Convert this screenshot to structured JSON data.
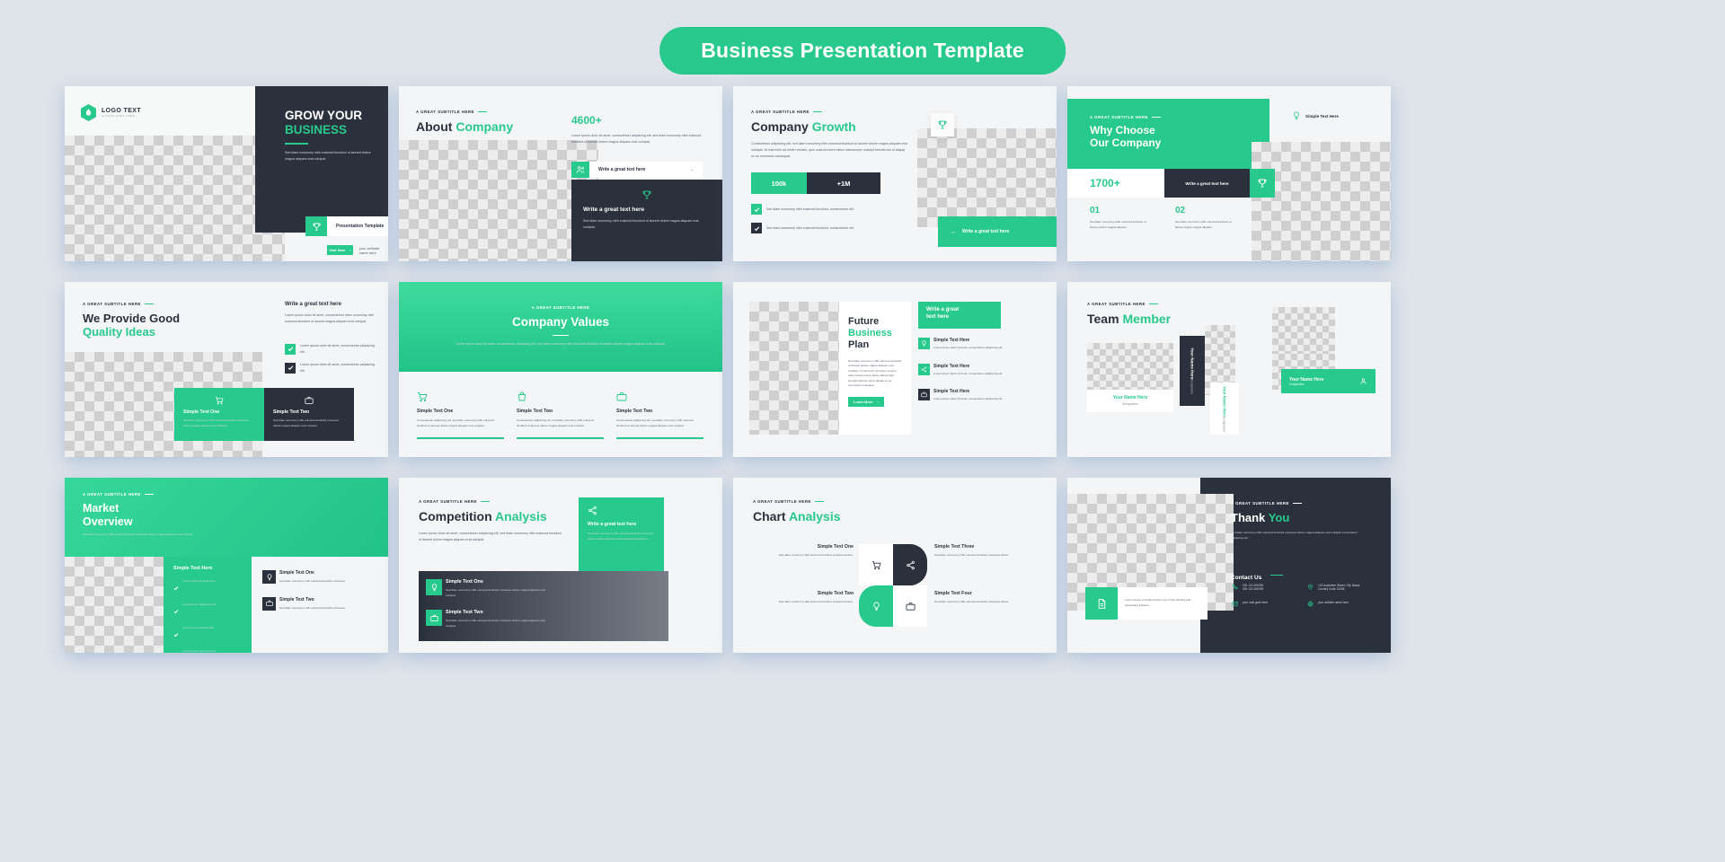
{
  "header": {
    "title": "Business Presentation Template"
  },
  "theme": {
    "accent": "#27c98c",
    "dark": "#2b313c",
    "page_bg": "#dfe3ea",
    "slide_bg": "#f4f5f6"
  },
  "common": {
    "eyebrow": "A GREAT SUBTITLE HERE",
    "lorem_short": "Lorem ipsum dolor sit amet, consectetuer adipiscing elit.",
    "lorem_mid": "Lorem ipsum dolor sit amet, consectetuer adipiscing elit, sed diam nonummy nibh euismod tincidunt ut laoreet dolore magna aliquam erat volutpat.",
    "lorem_long": "Consectetuer adipiscing elit, sed diam nonummy nibh euismod tincidunt ut laoreet dolore magna aliquam erat volutpat. Ut wisi enim ad minim veniam, quis nostrud exerci tation ullamcorper suscipit lobortis nisl ut aliquip ex ea commodo consequat.",
    "body_dark": "Sed diam nonummy nibh euismod tincidunt ut laoreet dolore magna aliquam erat volutpat.",
    "write_great": "Write a great text here",
    "simple_text_here": "Simple Text Here"
  },
  "slides": [
    {
      "id": "slide-cover",
      "logo": {
        "text": "LOGO TEXT",
        "slogan": "SLOGAN GOES HERE"
      },
      "title_line1": "GROW YOUR",
      "title_line2": "BUSINESS",
      "body": "Sed diam nonummy nibh euismod tincidunt ut laoreet dolore magna aliquam erat volutpat.",
      "cta_label": "Presentation Template",
      "visit_label": "Visit Now",
      "website_label": "your website name here"
    },
    {
      "id": "slide-about",
      "eyebrow": "A GREAT SUBTITLE HERE",
      "title_dark": "About",
      "title_green": "Company",
      "stat": "4600+",
      "stat_body": "Lorem ipsum dolor sit amet, consectetuer adipiscing elit, sed diam nonummy nibh euismod tincidunt ut laoreet dolore magna aliquam erat volutpat.",
      "button_label": "Write a great text here",
      "card_title": "Write a great text here",
      "card_body": "Sed diam nonummy nibh euismod tincidunt ut laoreet dolore magna aliquam erat volutpat."
    },
    {
      "id": "slide-growth",
      "eyebrow": "A GREAT SUBTITLE HERE",
      "title_dark": "Company",
      "title_green": "Growth",
      "body": "Consectetuer adipiscing elit, sed diam nonummy nibh euismod tincidunt ut laoreet dolore magna aliquam erat volutpat. Ut wisi enim ad minim veniam, quis nostrud exerci tation ullamcorper suscipit lobortis nisl ut aliquip ex ea commodo consequat.",
      "stat_green": "100k",
      "stat_dark": "+1M",
      "ticks": [
        "Sed diam nonummy nibh euismod tincidunt, consectetuer elit.",
        "Sed diam nonummy nibh euismod tincidunt, consectetuer elit."
      ],
      "ribbon_label": "Write a great text here"
    },
    {
      "id": "slide-why-choose",
      "eyebrow": "A GREAT SUBTITLE HERE",
      "title_line1": "Why Choose",
      "title_line2": "Our Company",
      "tag_label": "Simple Text Here",
      "stat": "1700+",
      "button_label": "Write a great text here",
      "items": [
        {
          "num": "01",
          "body": "Sed diam nonummy nibh euismod tincidunt ut laoreet dolore magna aliquam."
        },
        {
          "num": "02",
          "body": "Sed diam nonummy nibh euismod tincidunt ut laoreet dolore magna aliquam."
        }
      ]
    },
    {
      "id": "slide-quality-ideas",
      "eyebrow": "A GREAT SUBTITLE HERE",
      "title_line1": "We Provide Good",
      "title_line2": "Quality Ideas",
      "right_title": "Write a great text here",
      "right_body": "Lorem ipsum dolor sit amet, consectetuer diam nonummy nibh euismod tincidunt ut laoreet magna aliquam erat volutpat.",
      "ticks": [
        "Lorem ipsum dolor sit amet, consectetuer adipiscing elit.",
        "Lorem ipsum dolor sit amet, consectetuer adipiscing elit."
      ],
      "cards": [
        {
          "title": "Simple Text One",
          "body": "Sed diam nonummy nibh euismod tincidunt ut laoreet dolore magna aliquam erat volutpat.",
          "icon": "cart-icon"
        },
        {
          "title": "Simple Text Two",
          "body": "Sed diam nonummy nibh euismod tincidunt ut laoreet dolore magna aliquam erat volutpat.",
          "icon": "briefcase-icon"
        }
      ]
    },
    {
      "id": "slide-company-values",
      "eyebrow": "A GREAT SUBTITLE HERE",
      "title": "Company Values",
      "body": "Lorem ipsum dolor sit amet, consectetuer adipiscing elit, sed diam nonummy nibh euismod tincidunt ut laoreet dolore magna aliquam erat volutpat.",
      "cards": [
        {
          "title": "Simple Text One",
          "body": "Consectetuer adipiscing elit, sed diam nonummy nibh euismod tincidunt ut laoreet dolore magna aliquam erat volutpat.",
          "icon": "cart-icon"
        },
        {
          "title": "Simple Text Two",
          "body": "Consectetuer adipiscing elit, sed diam nonummy nibh euismod tincidunt ut laoreet dolore magna aliquam erat volutpat.",
          "icon": "bag-icon"
        },
        {
          "title": "Simple Text Two",
          "body": "Consectetuer adipiscing elit, sed diam nonummy nibh euismod tincidunt ut laoreet dolore magna aliquam erat volutpat.",
          "icon": "briefcase-icon"
        }
      ]
    },
    {
      "id": "slide-business-plan",
      "title_line1": "Future",
      "title_line2": "Business",
      "title_line3": "Plan",
      "body": "Sed diam nonummy nibh euismod tincidunt ut laoreet dolore magna aliquam erat volutpat. Ut wisi enim ad minim veniam, quis nostrud exerci tation ullamcorper suscipit lobortis nisl ut aliquip ex ea commodo consequat.",
      "cta_label": "Learn More",
      "banner_line1": "Write a great",
      "banner_line2": "text here",
      "items": [
        {
          "title": "Simple Text Here",
          "body": "Lorem ipsum dolor sit amet, consectetuer adipiscing elit.",
          "icon": "bulb-icon"
        },
        {
          "title": "Simple Text Here",
          "body": "Lorem ipsum dolor sit amet, consectetuer adipiscing elit.",
          "icon": "share-icon"
        },
        {
          "title": "Simple Text Here",
          "body": "Lorem ipsum dolor sit amet, consectetuer adipiscing elit.",
          "icon": "briefcase-icon"
        }
      ]
    },
    {
      "id": "slide-team",
      "eyebrow": "A GREAT SUBTITLE HERE",
      "title_dark": "Team",
      "title_green": "Member",
      "members": [
        {
          "name": "Your Name Here",
          "role": "Designation"
        },
        {
          "name": "Your Name Here",
          "role": "Designation"
        },
        {
          "name": "Your Name Here",
          "role": "Designation"
        },
        {
          "name": "Your Name Here",
          "role": "Designation"
        }
      ]
    },
    {
      "id": "slide-market-overview",
      "eyebrow": "A GREAT SUBTITLE HERE",
      "title_line1": "Market",
      "title_line2": "Overview",
      "body": "Sed diam nonummy nibh euismod tincidunt ut laoreet dolore magna aliquam erat volutpat.",
      "panel_title": "Simple Text Here",
      "bullets": [
        "Lorem ipsum is simply text",
        "consectetuer adipiscing elit",
        "Currency is popular belief",
        "Lorem ipsum dolor sit amet"
      ],
      "cards": [
        {
          "title": "Simple Text One",
          "body": "Sed diam nonummy nibh euismod tincidunt ut laoreet.",
          "icon": "bulb-icon"
        },
        {
          "title": "Simple Text Two",
          "body": "Sed diam nonummy nibh euismod tincidunt ut laoreet.",
          "icon": "briefcase-icon"
        }
      ]
    },
    {
      "id": "slide-competition",
      "eyebrow": "A GREAT SUBTITLE HERE",
      "title_dark": "Competition",
      "title_green": "Analysis",
      "body": "Lorem ipsum dolor sit amet, consectetuer adipiscing elit, sed diam nonummy nibh euismod tincidunt ut laoreet dolore magna aliquam erat volutpat.",
      "banner_title": "Write a great text here",
      "banner_body": "Sed diam nonummy nibh euismod tincidunt ut laoreet dolore magna aliquam erat volutpat consectetuer.",
      "cards": [
        {
          "title": "Simple Text One",
          "body": "Sed diam nonummy nibh euismod tincidunt ut laoreet dolore magna aliquam erat volutpat.",
          "icon": "bulb-icon"
        },
        {
          "title": "Simple Text Two",
          "body": "Sed diam nonummy nibh euismod tincidunt ut laoreet dolore magna aliquam erat volutpat.",
          "icon": "briefcase-icon"
        }
      ]
    },
    {
      "id": "slide-chart-analysis",
      "eyebrow": "A GREAT SUBTITLE HERE",
      "title_dark": "Chart",
      "title_green": "Analysis",
      "items": [
        {
          "title": "Simple Text One",
          "body": "Sed diam nonummy nibh euismod tincidunt ut laoreet dolore.",
          "icon": "cart-icon",
          "side": "left"
        },
        {
          "title": "Simple Text Two",
          "body": "Sed diam nonummy nibh euismod tincidunt ut laoreet dolore.",
          "icon": "bulb-icon",
          "side": "left"
        },
        {
          "title": "Simple Text Three",
          "body": "Sed diam nonummy nibh euismod tincidunt ut laoreet dolore.",
          "icon": "share-icon",
          "side": "right"
        },
        {
          "title": "Simple Text Four",
          "body": "Sed diam nonummy nibh euismod tincidunt ut laoreet dolore.",
          "icon": "briefcase-icon",
          "side": "right"
        }
      ]
    },
    {
      "id": "slide-thank-you",
      "eyebrow": "A GREAT SUBTITLE HERE",
      "title_light": "Thank",
      "title_green": "You",
      "body": "Sed diam nonummy nibh euismod tincidunt ut laoreet dolore magna aliquam erat volutpat consectetuer adipiscing elit.",
      "contact_heading": "Contact Us",
      "note": "Lorem ipsum is simply dummy text of the printing and typesetting industry.",
      "contacts": [
        {
          "icon": "phone-icon",
          "line1": "000 123 456789",
          "line2": "000 123 456789"
        },
        {
          "icon": "location-icon",
          "line1": "123 Anywhere Street, City Name,",
          "line2": "Country Code 12345"
        },
        {
          "icon": "mail-icon",
          "line1": "your mail goes here",
          "line2": ""
        },
        {
          "icon": "globe-icon",
          "line1": "your website name here",
          "line2": ""
        }
      ]
    }
  ]
}
